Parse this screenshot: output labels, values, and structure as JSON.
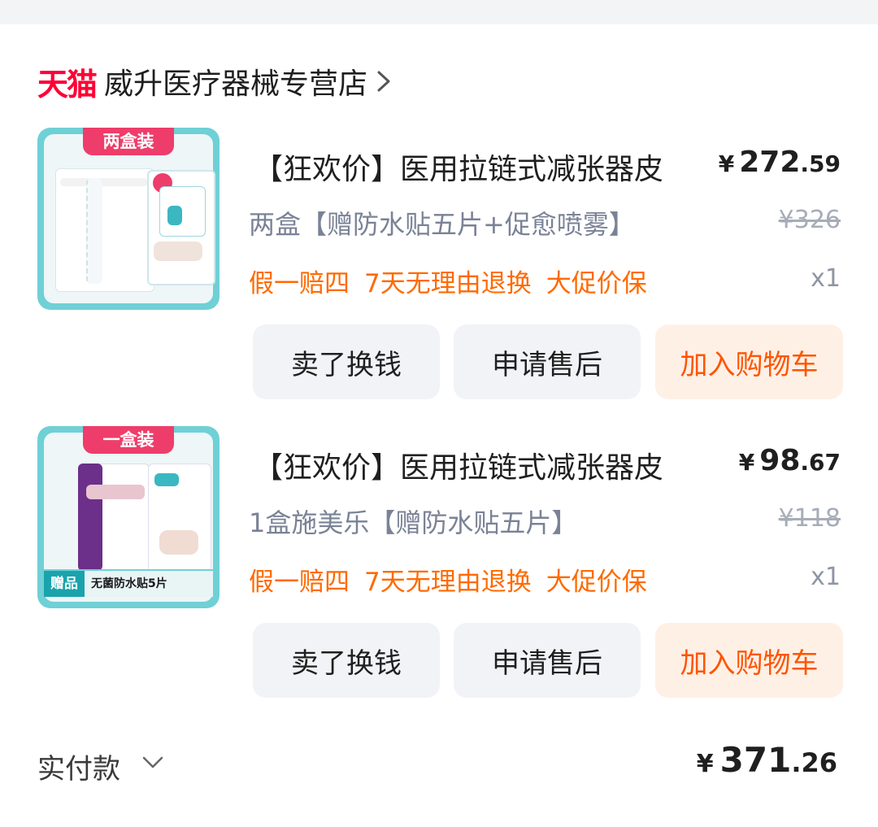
{
  "shop": {
    "logo": "天猫",
    "name": "威升医疗器械专营店"
  },
  "items": [
    {
      "tag": "两盒装",
      "title": "【狂欢价】医用拉链式减张器皮",
      "price_int": "272",
      "price_dec": ".59",
      "yen": "¥",
      "variant": "两盒【赠防水贴五片+促愈喷雾】",
      "orig_price": "¥326",
      "badges": [
        "假一赔四",
        "7天无理由退换",
        "大促价保"
      ],
      "qty": "x1",
      "buttons": {
        "sell": "卖了换钱",
        "after_sale": "申请售后",
        "cart": "加入购物车"
      }
    },
    {
      "tag": "一盒装",
      "title": "【狂欢价】医用拉链式减张器皮",
      "price_int": "98",
      "price_dec": ".67",
      "yen": "¥",
      "variant": "1盒施美乐【赠防水贴五片】",
      "orig_price": "¥118",
      "badges": [
        "假一赔四",
        "7天无理由退换",
        "大促价保"
      ],
      "qty": "x1",
      "gift_badge": "赠品",
      "gift_text": "无菌防水贴5片",
      "buttons": {
        "sell": "卖了换钱",
        "after_sale": "申请售后",
        "cart": "加入购物车"
      }
    }
  ],
  "total": {
    "label": "实付款",
    "yen": "¥",
    "int": "371",
    "dec": ".26"
  },
  "colors": {
    "brand_red": "#ff0036",
    "accent_orange": "#ff6a00",
    "cart_bg": "#fff0e6",
    "teal": "#6fd0d6"
  }
}
